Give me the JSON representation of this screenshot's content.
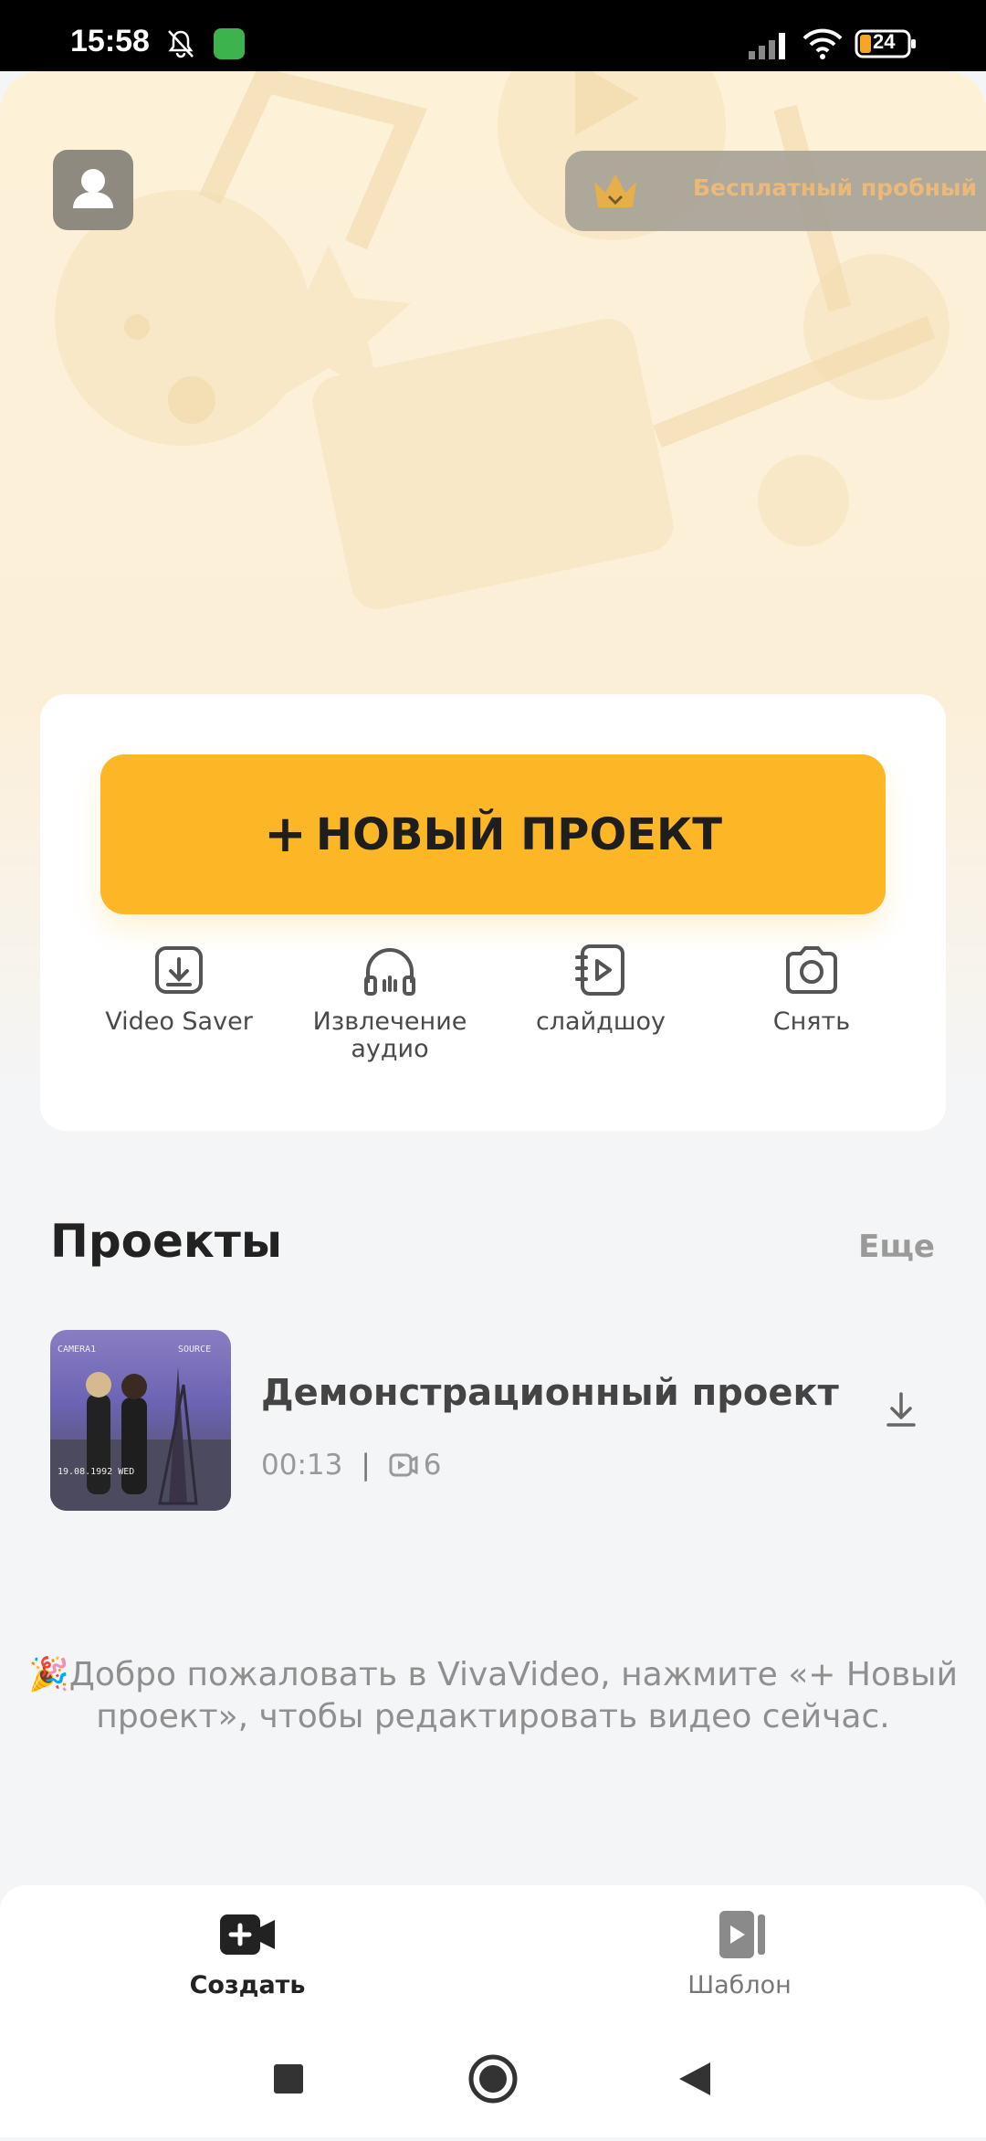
{
  "status_bar": {
    "time": "15:58",
    "battery": "24"
  },
  "header": {
    "trial_label": "Бесплатный пробный"
  },
  "create_card": {
    "new_project_label": "НОВЫЙ ПРОЕКТ",
    "tools": [
      {
        "label": "Video Saver",
        "icon": "download-box-icon"
      },
      {
        "label": "Извлечение аудио",
        "icon": "headphones-icon"
      },
      {
        "label": "слайдшоу",
        "icon": "slideshow-icon"
      },
      {
        "label": "Снять",
        "icon": "camera-icon"
      }
    ]
  },
  "projects": {
    "title": "Проекты",
    "more_label": "Еще",
    "items": [
      {
        "name": "Демонстрационный проект",
        "duration": "00:13",
        "clips": "6"
      }
    ]
  },
  "welcome_text": "🎉Добро пожаловать в VivaVideo, нажмите «+ Новый проект», чтобы редактировать видео сейчас.",
  "tabs": [
    {
      "label": "Создать",
      "active": true
    },
    {
      "label": "Шаблон",
      "active": false
    }
  ],
  "colors": {
    "accent": "#fdb625",
    "trial_text": "#e9b36f",
    "status_bar": "#000000"
  }
}
